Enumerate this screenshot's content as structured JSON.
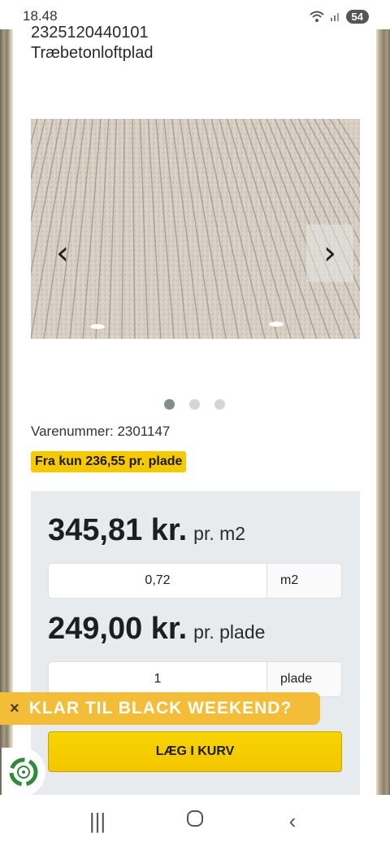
{
  "status_bar": {
    "time": "18.48",
    "battery": "54"
  },
  "product": {
    "sku_header": "2325120440101",
    "name": "Træbetonloftplad",
    "item_number": "Varenummer: 2301147",
    "price_badge": "Fra kun 236,55 pr. plade"
  },
  "carousel": {
    "image": "wood-wool-ceiling-panels",
    "prev_icon": "chevron-left-icon",
    "next_icon": "chevron-right-icon",
    "dots": 3,
    "active_dot": 1
  },
  "pricing": {
    "price_m2": "345,81 kr.",
    "unit_m2": "pr. m2",
    "qty_m2": "0,72",
    "qty_m2_unit": "m2",
    "price_plate": "249,00 kr.",
    "unit_plate": "pr. plade",
    "qty_plate": "1",
    "qty_plate_unit": "plade",
    "add_to_cart": "LÆG I KURV"
  },
  "promo": {
    "close": "×",
    "text": "KLAR TIL BLACK WEEKEND?"
  },
  "colors": {
    "accent_yellow": "#f7c900",
    "promo": "#f3bd38",
    "panel": "#e8ebed"
  }
}
